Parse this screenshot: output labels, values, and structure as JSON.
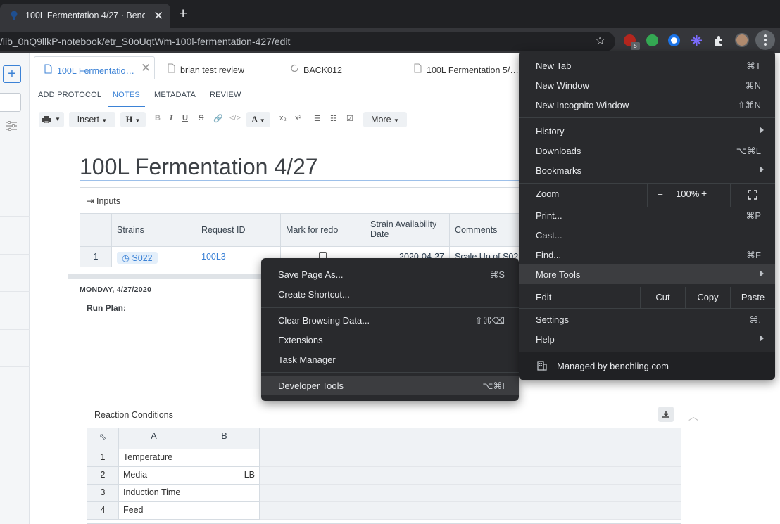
{
  "browser": {
    "tab_title": "100L Fermentation 4/27 · Bench",
    "new_tab_symbol": "+",
    "close_symbol": "✕",
    "url": "/lib_0nQ9llkP-notebook/etr_S0oUqtWm-100l-fermentation-427/edit",
    "extension_badge": "5"
  },
  "app": {
    "doc_tabs": [
      {
        "label": "100L Fermentatio…"
      },
      {
        "label": "brian test review"
      },
      {
        "label": "BACK012"
      },
      {
        "label": "100L Fermentation 5/…"
      }
    ],
    "subnav": [
      "ADD PROTOCOL",
      "NOTES",
      "METADATA",
      "REVIEW"
    ],
    "toolbar": {
      "insert": "Insert",
      "heading": "H",
      "more": "More"
    },
    "doc_title": "100L Fermentation 4/27",
    "inputs": {
      "heading": "Inputs",
      "columns": [
        "Strains",
        "Request ID",
        "Mark for redo",
        "Strain Availability Date",
        "Comments"
      ],
      "rows": [
        {
          "num": "1",
          "strain": "S022",
          "request_id": "100L3",
          "date": "2020-04-27",
          "comments": "Scale Up of S022"
        }
      ]
    },
    "date_label": "MONDAY, 4/27/2020",
    "run_plan": "Run Plan:",
    "reaction_conditions": {
      "heading": "Reaction Conditions",
      "columns": [
        "A",
        "B"
      ],
      "rows": [
        {
          "num": "1",
          "a": "Temperature",
          "b": ""
        },
        {
          "num": "2",
          "a": "Media",
          "b": "LB"
        },
        {
          "num": "3",
          "a": "Induction Time",
          "b": ""
        },
        {
          "num": "4",
          "a": "Feed",
          "b": ""
        }
      ]
    }
  },
  "chrome_menu": {
    "new_tab": {
      "label": "New Tab",
      "shortcut": "⌘T"
    },
    "new_window": {
      "label": "New Window",
      "shortcut": "⌘N"
    },
    "new_incognito": {
      "label": "New Incognito Window",
      "shortcut": "⇧⌘N"
    },
    "history": {
      "label": "History"
    },
    "downloads": {
      "label": "Downloads",
      "shortcut": "⌥⌘L"
    },
    "bookmarks": {
      "label": "Bookmarks"
    },
    "zoom": {
      "label": "Zoom",
      "minus": "–",
      "value": "100%",
      "plus": "+"
    },
    "print": {
      "label": "Print...",
      "shortcut": "⌘P"
    },
    "cast": {
      "label": "Cast..."
    },
    "find": {
      "label": "Find...",
      "shortcut": "⌘F"
    },
    "more_tools": {
      "label": "More Tools"
    },
    "edit": {
      "label": "Edit",
      "cut": "Cut",
      "copy": "Copy",
      "paste": "Paste"
    },
    "settings": {
      "label": "Settings",
      "shortcut": "⌘,"
    },
    "help": {
      "label": "Help"
    },
    "managed": "Managed by benchling.com"
  },
  "more_tools_menu": {
    "save_page": {
      "label": "Save Page As...",
      "shortcut": "⌘S"
    },
    "create_shortcut": {
      "label": "Create Shortcut..."
    },
    "clear_browsing": {
      "label": "Clear Browsing Data...",
      "shortcut": "⇧⌘⌫"
    },
    "extensions": {
      "label": "Extensions"
    },
    "task_manager": {
      "label": "Task Manager"
    },
    "developer_tools": {
      "label": "Developer Tools",
      "shortcut": "⌥⌘I"
    }
  }
}
